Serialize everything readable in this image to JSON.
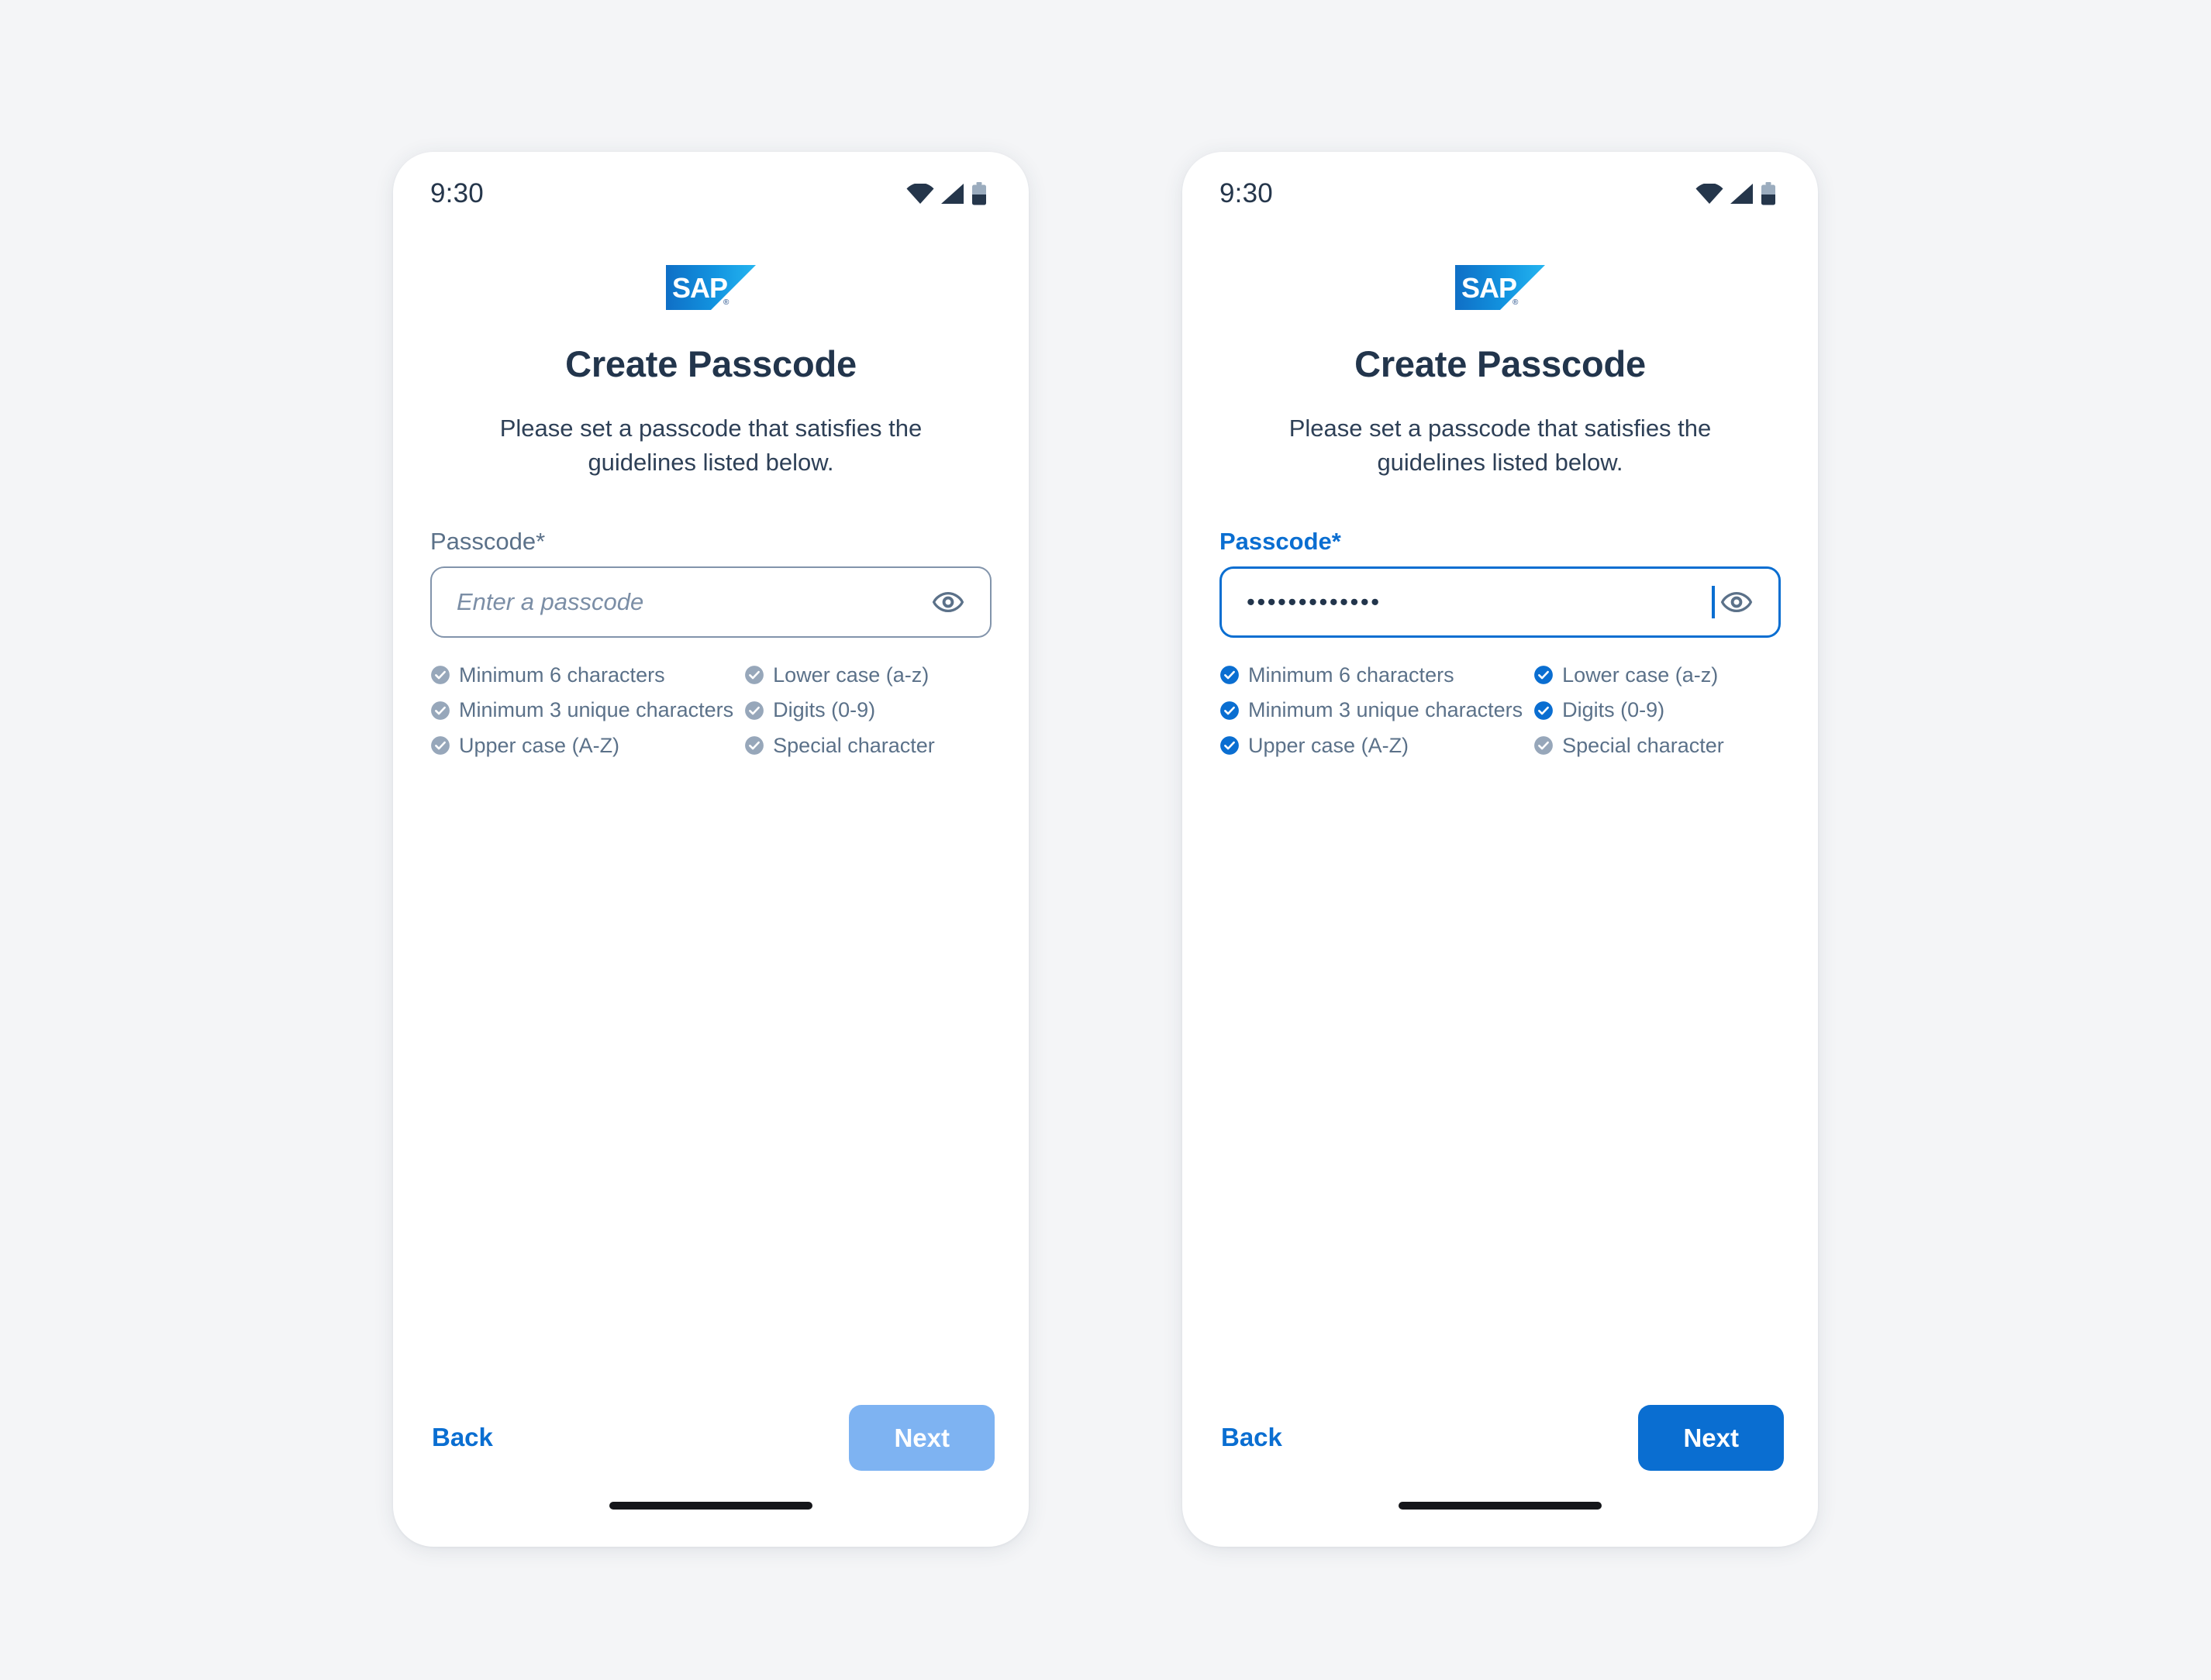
{
  "page": {
    "background_color": "#f4f5f7",
    "accent_color": "#0a6ed1",
    "accent_disabled_color": "#7eb3f2",
    "text_dark_color": "#22354c",
    "text_muted_color": "#5b7189",
    "inactive_check_color": "#97a7ba"
  },
  "screens": [
    {
      "id": "empty-state",
      "status_bar": {
        "time": "9:30",
        "icons": [
          "wifi-icon",
          "cellular-signal-icon",
          "battery-icon"
        ]
      },
      "logo": {
        "name": "sap-logo",
        "text": "SAP"
      },
      "title": "Create Passcode",
      "subtitle": "Please set a passcode that satisfies the guidelines listed below.",
      "field": {
        "label": "Passcode*",
        "value": "",
        "placeholder": "Enter a passcode",
        "focused": false,
        "masked": true,
        "reveal_icon": "eye-icon"
      },
      "rules": [
        {
          "label": "Minimum 6 characters",
          "satisfied": false
        },
        {
          "label": "Lower case (a-z)",
          "satisfied": false
        },
        {
          "label": "Minimum 3 unique characters",
          "satisfied": false
        },
        {
          "label": "Digits (0-9)",
          "satisfied": false
        },
        {
          "label": "Upper case (A-Z)",
          "satisfied": false
        },
        {
          "label": "Special character",
          "satisfied": false
        }
      ],
      "footer": {
        "back_label": "Back",
        "next_label": "Next",
        "next_enabled": false
      }
    },
    {
      "id": "filled-state",
      "status_bar": {
        "time": "9:30",
        "icons": [
          "wifi-icon",
          "cellular-signal-icon",
          "battery-icon"
        ]
      },
      "logo": {
        "name": "sap-logo",
        "text": "SAP"
      },
      "title": "Create Passcode",
      "subtitle": "Please set a passcode that satisfies the guidelines listed below.",
      "field": {
        "label": "Passcode*",
        "value": "•••••••••••••",
        "value_length": 13,
        "placeholder": "Enter a passcode",
        "focused": true,
        "masked": true,
        "reveal_icon": "eye-icon"
      },
      "rules": [
        {
          "label": "Minimum 6 characters",
          "satisfied": true
        },
        {
          "label": "Lower case (a-z)",
          "satisfied": true
        },
        {
          "label": "Minimum 3 unique characters",
          "satisfied": true
        },
        {
          "label": "Digits (0-9)",
          "satisfied": true
        },
        {
          "label": "Upper case (A-Z)",
          "satisfied": true
        },
        {
          "label": "Special character",
          "satisfied": false
        }
      ],
      "footer": {
        "back_label": "Back",
        "next_label": "Next",
        "next_enabled": true
      }
    }
  ]
}
